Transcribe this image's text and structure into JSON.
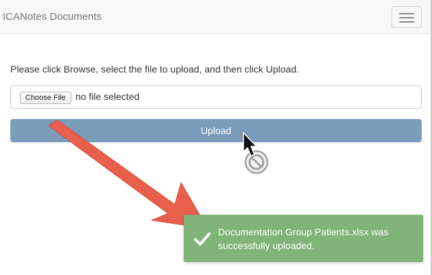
{
  "navbar": {
    "brand": "ICANotes Documents",
    "menu_icon": "hamburger-menu-icon"
  },
  "upload_form": {
    "instructions": "Please click Browse, select the file to upload, and then click Upload.",
    "choose_file_label": "Choose File",
    "file_status": "no file selected",
    "upload_label": "Upload"
  },
  "toast": {
    "icon": "checkmark-icon",
    "message": "Documentation Group Patients.xlsx was successfully uploaded."
  },
  "annotations": {
    "arrow_icon": "red-arrow-icon",
    "cursor_icon": "mouse-pointer-icon",
    "not_allowed_icon": "not-allowed-icon"
  },
  "colors": {
    "upload_button": "#7b9bbb",
    "toast_background": "#81b478",
    "annotation_arrow": "#e8604c"
  }
}
